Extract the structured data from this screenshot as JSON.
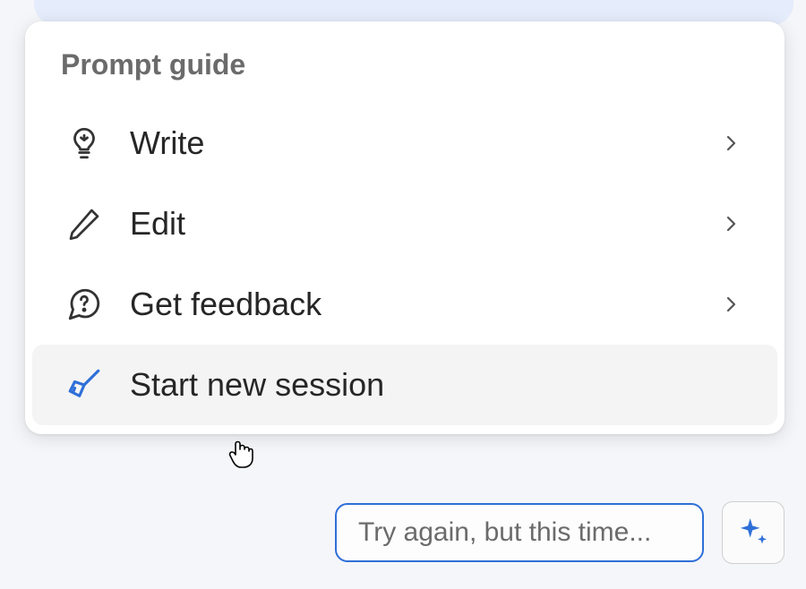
{
  "panel": {
    "title": "Prompt guide",
    "items": [
      {
        "label": "Write",
        "has_chevron": true
      },
      {
        "label": "Edit",
        "has_chevron": true
      },
      {
        "label": "Get feedback",
        "has_chevron": true
      },
      {
        "label": "Start new session",
        "has_chevron": false
      }
    ]
  },
  "input": {
    "placeholder": "Try again, but this time..."
  },
  "colors": {
    "accent": "#2f6fd8",
    "icon_stroke": "#333333"
  }
}
